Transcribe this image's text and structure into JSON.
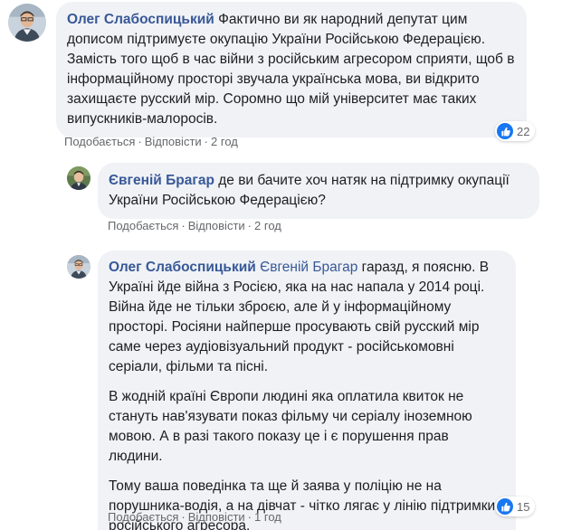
{
  "comments": [
    {
      "author": "Олег Слабоспицький",
      "mention": "",
      "paragraphs": [
        " Фактично ви як народний депутат цим дописом підтримуєте окупацію України Російською Федерацією. Замість того щоб в час війни з російським агресором сприяти, щоб в інформаційному просторі звучала українська мова, ви відкрито захищаєте русский мір. Соромно що мій університет має таких випускників-малоросів."
      ],
      "actions": {
        "like": "Подобається",
        "reply": "Відповісти",
        "time": "2 год"
      },
      "reaction_count": "22",
      "reaction_icon": "like-icon"
    },
    {
      "author": "Євгеній Брагар",
      "mention": "",
      "paragraphs": [
        " де ви бачите хоч натяк на підтримку окупації України Російською Федерацією?"
      ],
      "actions": {
        "like": "Подобається",
        "reply": "Відповісти",
        "time": "2 год"
      }
    },
    {
      "author": "Олег Слабоспицький",
      "mention": "Євгеній Брагар",
      "paragraphs": [
        " гаразд, я поясню. В Україні йде війна з Росією, яка на нас напала у 2014 році. Війна йде не тільки зброєю, але й у інформаційному просторі. Росіяни найперше просувають свій русский мір саме через аудіовізуальний продукт - російськомовні серіали, фільми та пісні.",
        "В жодній країні Європи людині яка оплатила квиток не стануть нав'язувати показ фільму чи серіалу іноземною мовою. А в разі такого показу це і є порушення прав людини.",
        "Тому ваша поведінка та ще й заява у поліцію не на порушника-водія, а на дівчат - чітко лягає у лінію підтримки російського агресора."
      ],
      "actions": {
        "like": "Подобається",
        "reply": "Відповісти",
        "time": "1 год"
      },
      "reaction_count": "15",
      "reaction_icon": "like-icon"
    }
  ],
  "colors": {
    "link": "#385898",
    "bubble": "#f0f2f5",
    "like": "#1877f2",
    "meta": "#65676b"
  }
}
